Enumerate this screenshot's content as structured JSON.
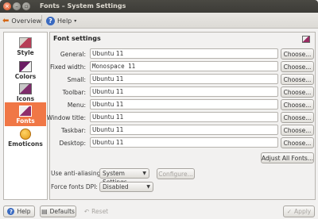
{
  "window": {
    "title": "Fonts – System Settings"
  },
  "toolbar": {
    "overview_label": "Overview",
    "help_label": "Help"
  },
  "sidebar": {
    "items": [
      {
        "label": "Style",
        "active": false
      },
      {
        "label": "Colors",
        "active": false
      },
      {
        "label": "Icons",
        "active": false
      },
      {
        "label": "Fonts",
        "active": true
      },
      {
        "label": "Emoticons",
        "active": false
      }
    ]
  },
  "panel": {
    "title": "Font settings",
    "choose_label": "Choose...",
    "rows": [
      {
        "label": "General:",
        "value": "Ubuntu 11"
      },
      {
        "label": "Fixed width:",
        "value": "Monospace 11"
      },
      {
        "label": "Small:",
        "value": "Ubuntu 11"
      },
      {
        "label": "Toolbar:",
        "value": "Ubuntu 11"
      },
      {
        "label": "Menu:",
        "value": "Ubuntu 11"
      },
      {
        "label": "Window title:",
        "value": "Ubuntu 11"
      },
      {
        "label": "Taskbar:",
        "value": "Ubuntu 11"
      },
      {
        "label": "Desktop:",
        "value": "Ubuntu 11"
      }
    ],
    "adjust_all_label": "Adjust All Fonts...",
    "anti_aliasing": {
      "label": "Use anti-aliasing:",
      "value": "System Settings",
      "configure_label": "Configure..."
    },
    "force_dpi": {
      "label": "Force fonts DPI:",
      "value": "Disabled"
    }
  },
  "bottom": {
    "help_label": "Help",
    "defaults_label": "Defaults",
    "reset_label": "Reset",
    "apply_label": "Apply"
  },
  "colors": {
    "accent": "#f07746",
    "titlebar": "#3c3b37"
  }
}
